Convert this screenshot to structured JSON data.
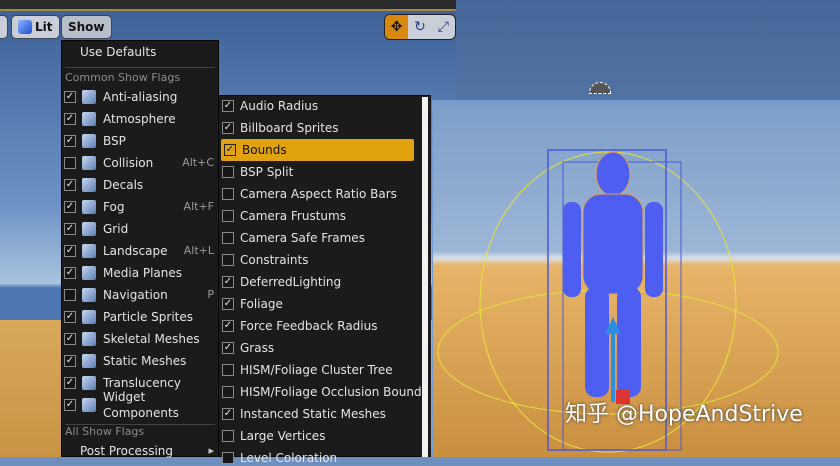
{
  "toolbar": {
    "lit_label": "Lit",
    "show_label": "Show",
    "gizmo": [
      "translate-icon",
      "rotate-icon",
      "scale-icon"
    ]
  },
  "menu": {
    "use_defaults": "Use Defaults",
    "common_header": "Common Show Flags",
    "common_items": [
      {
        "label": "Anti-aliasing",
        "checked": true,
        "shortcut": ""
      },
      {
        "label": "Atmosphere",
        "checked": true,
        "shortcut": ""
      },
      {
        "label": "BSP",
        "checked": true,
        "shortcut": ""
      },
      {
        "label": "Collision",
        "checked": false,
        "shortcut": "Alt+C"
      },
      {
        "label": "Decals",
        "checked": true,
        "shortcut": ""
      },
      {
        "label": "Fog",
        "checked": true,
        "shortcut": "Alt+F"
      },
      {
        "label": "Grid",
        "checked": true,
        "shortcut": ""
      },
      {
        "label": "Landscape",
        "checked": true,
        "shortcut": "Alt+L"
      },
      {
        "label": "Media Planes",
        "checked": true,
        "shortcut": ""
      },
      {
        "label": "Navigation",
        "checked": false,
        "shortcut": "P"
      },
      {
        "label": "Particle Sprites",
        "checked": true,
        "shortcut": ""
      },
      {
        "label": "Skeletal Meshes",
        "checked": true,
        "shortcut": ""
      },
      {
        "label": "Static Meshes",
        "checked": true,
        "shortcut": ""
      },
      {
        "label": "Translucency",
        "checked": true,
        "shortcut": ""
      },
      {
        "label": "Widget Components",
        "checked": true,
        "shortcut": ""
      }
    ],
    "all_header": "All Show Flags",
    "post_processing": "Post Processing"
  },
  "submenu": {
    "highlighted": "Bounds",
    "items": [
      {
        "label": "Audio Radius",
        "checked": true
      },
      {
        "label": "Billboard Sprites",
        "checked": true
      },
      {
        "label": "Bounds",
        "checked": true
      },
      {
        "label": "BSP Split",
        "checked": false
      },
      {
        "label": "Camera Aspect Ratio Bars",
        "checked": false
      },
      {
        "label": "Camera Frustums",
        "checked": false
      },
      {
        "label": "Camera Safe Frames",
        "checked": false
      },
      {
        "label": "Constraints",
        "checked": false
      },
      {
        "label": "DeferredLighting",
        "checked": true
      },
      {
        "label": "Foliage",
        "checked": true
      },
      {
        "label": "Force Feedback Radius",
        "checked": true
      },
      {
        "label": "Grass",
        "checked": true
      },
      {
        "label": "HISM/Foliage Cluster Tree",
        "checked": false
      },
      {
        "label": "HISM/Foliage Occlusion Bounds",
        "checked": false
      },
      {
        "label": "Instanced Static Meshes",
        "checked": true
      },
      {
        "label": "Large Vertices",
        "checked": false
      },
      {
        "label": "Level Coloration",
        "checked": false
      }
    ]
  },
  "watermark": "知乎 @HopeAndStrive",
  "colors": {
    "accent": "#e0a20d",
    "menu_bg": "#1b1b1b"
  }
}
